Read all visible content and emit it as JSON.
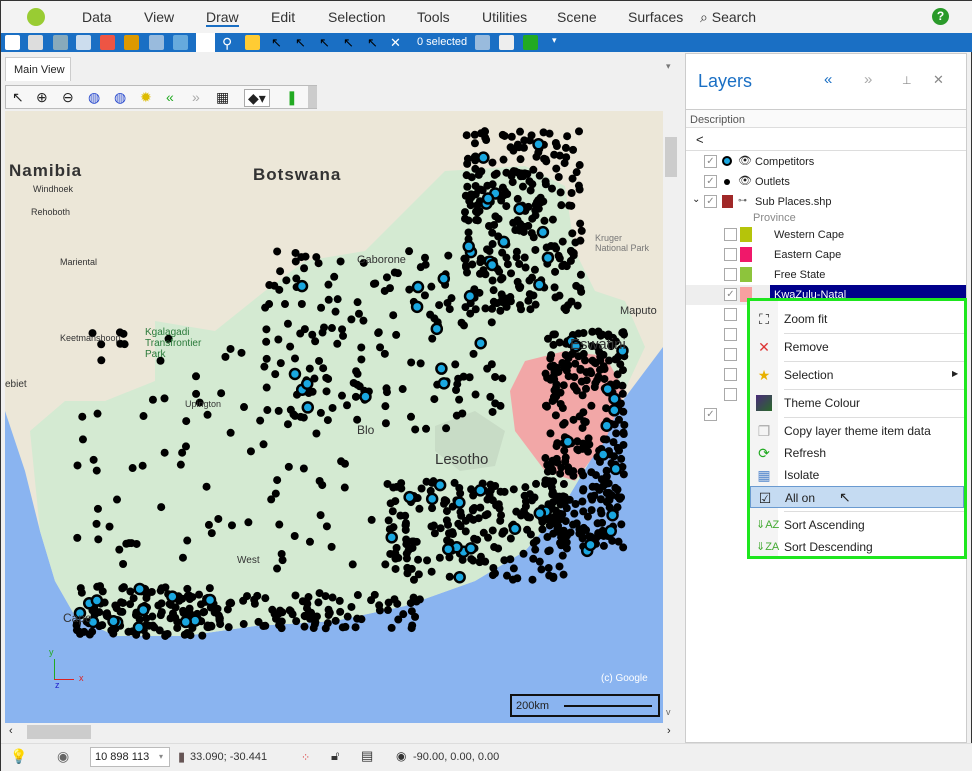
{
  "menubar": {
    "items": [
      "Data",
      "View",
      "Draw",
      "Edit",
      "Selection",
      "Tools",
      "Utilities",
      "Scene",
      "Surfaces"
    ],
    "search": "Search",
    "active": "Draw"
  },
  "toolbar": {
    "selected_count": "0 selected"
  },
  "tabs": {
    "main_view": "Main View"
  },
  "map": {
    "labels": {
      "namibia": "Namibia",
      "windhoek": "Windhoek",
      "rehoboth": "Rehoboth",
      "mariental": "Mariental",
      "keetmanshoop": "Keetmanshoop",
      "botswana": "Botswana",
      "gaborone": "Gaborone",
      "kgalagadi": "Kgalagadi Transfrontier Park",
      "upington": "Upington",
      "kruger": "Kruger National Park",
      "maputo": "Maputo",
      "eswatini": "Eswatini",
      "lesotho": "Lesotho",
      "bloemfontein": "Blo",
      "cape": "Cape",
      "ebiet": "ebiet",
      "west": "West",
      "google": "(c) Google"
    },
    "scale": "200km",
    "axes": {
      "y": "y",
      "z": "z",
      "x": "x"
    },
    "colors": {
      "sea": "#8ab4f0",
      "outlets": "#000000",
      "competitors": "#1aa7e0",
      "kzn": "#f2a7a7"
    }
  },
  "status": {
    "scale_value": "10 898 113",
    "coords": "33.090; -30.441",
    "view_angles": "-90.00, 0.00, 0.00"
  },
  "layers": {
    "title": "Layers",
    "column": "Description",
    "back": "<",
    "items": [
      {
        "name": "Competitors",
        "checked": true
      },
      {
        "name": "Outlets",
        "checked": true
      },
      {
        "name": "Sub Places.shp",
        "checked": true
      }
    ],
    "group_label": "Province",
    "provinces": [
      {
        "name": "Western Cape",
        "color": "#b5c40a",
        "checked": false
      },
      {
        "name": "Eastern Cape",
        "color": "#f0186a",
        "checked": false
      },
      {
        "name": "Free State",
        "color": "#8dc43c",
        "checked": false
      },
      {
        "name": "KwaZulu-Natal",
        "color": "#f7a0a0",
        "checked": true
      }
    ]
  },
  "context_menu": {
    "items": [
      {
        "label": "Zoom fit",
        "icon": "zoom-fit-icon"
      },
      {
        "label": "Remove",
        "icon": "remove-x-icon"
      },
      {
        "label": "Selection",
        "icon": "star-icon",
        "submenu": true
      },
      {
        "label": "Theme Colour",
        "icon": "theme-colour-icon"
      },
      {
        "label": "Copy layer theme item data",
        "icon": "copy-icon"
      },
      {
        "label": "Refresh",
        "icon": "refresh-icon"
      },
      {
        "label": "Isolate",
        "icon": "isolate-icon"
      },
      {
        "label": "All on",
        "icon": "checkbox-icon",
        "highlighted": true
      },
      {
        "label": "Sort Ascending",
        "icon": "sort-ascending-icon"
      },
      {
        "label": "Sort Descending",
        "icon": "sort-descending-icon"
      }
    ]
  }
}
